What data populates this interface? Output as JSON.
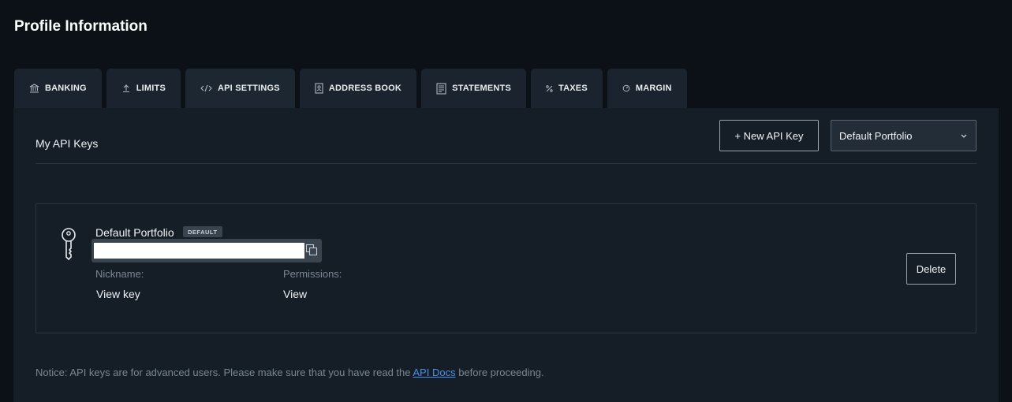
{
  "page": {
    "title": "Profile Information"
  },
  "tabs": [
    {
      "label": "BANKING",
      "icon": "bank-icon"
    },
    {
      "label": "LIMITS",
      "icon": "upload-arrow-icon"
    },
    {
      "label": "API SETTINGS",
      "icon": "code-icon"
    },
    {
      "label": "ADDRESS BOOK",
      "icon": "address-book-icon"
    },
    {
      "label": "STATEMENTS",
      "icon": "document-icon"
    },
    {
      "label": "TAXES",
      "icon": "percent-icon"
    },
    {
      "label": "MARGIN",
      "icon": "gauge-icon"
    }
  ],
  "active_tab": "API SETTINGS",
  "panel": {
    "title": "My API Keys",
    "new_key_button": "+ New API Key",
    "portfolio_select": {
      "value": "Default Portfolio"
    }
  },
  "key_card": {
    "portfolio_name": "Default Portfolio",
    "badge": "DEFAULT",
    "key_value": "",
    "nickname_label": "Nickname:",
    "nickname_value": "View key",
    "permissions_label": "Permissions:",
    "permissions_value": "View",
    "delete_button": "Delete"
  },
  "notice": {
    "before": "Notice: API keys are for advanced users. Please make sure that you have read the ",
    "link": "API Docs",
    "after": " before proceeding."
  },
  "colors": {
    "background": "#0b1117",
    "panel": "#151e27",
    "tab": "#1b242e",
    "link": "#4b8fe8"
  }
}
